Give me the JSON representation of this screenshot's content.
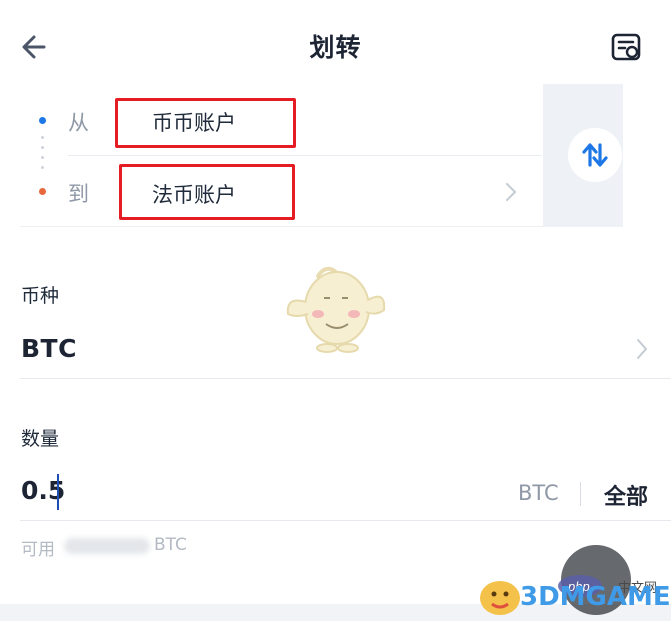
{
  "header": {
    "title": "划转",
    "back_icon": "arrow-left-icon",
    "record_icon": "transfer-record-icon"
  },
  "transfer": {
    "from_label": "从",
    "from_account": "币币账户",
    "to_label": "到",
    "to_account": "法币账户",
    "swap_icon": "swap-arrows-icon",
    "colors": {
      "accent": "#1d77e6",
      "from_dot": "#1d77e6",
      "to_dot": "#e8673c",
      "highlight": "#e51c23"
    }
  },
  "coin": {
    "label": "币种",
    "value": "BTC"
  },
  "amount": {
    "label": "数量",
    "value": "0.5",
    "unit": "BTC",
    "all_label": "全部",
    "available_prefix": "可用",
    "available_unit": "BTC"
  },
  "watermark": {
    "text": "3DMGAME",
    "php_text": "php",
    "cn_text": "中文网"
  }
}
